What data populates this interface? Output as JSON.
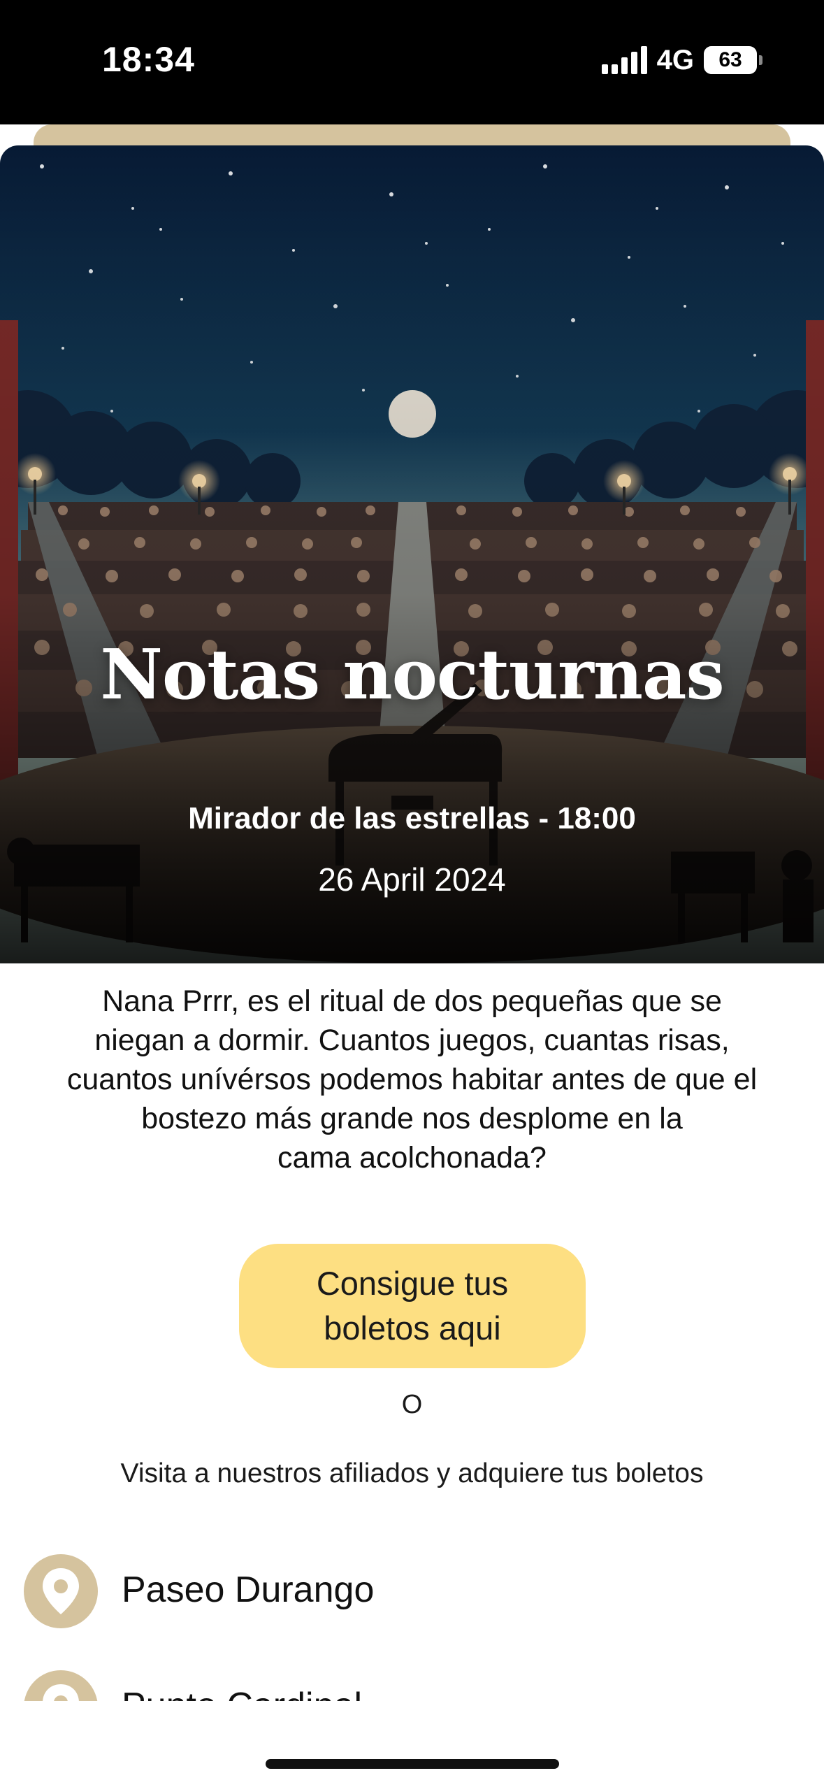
{
  "status_bar": {
    "time": "18:34",
    "network": "4G",
    "battery": "63",
    "signal_icon": "cellular-signal-icon",
    "battery_icon": "battery-icon"
  },
  "event": {
    "title": "Notas nocturnas",
    "venue_time": "Mirador de las estrellas - 18:00",
    "date": "26 April 2024",
    "description": "Nana Prrr, es el ritual  de dos pequeñas que se\nniegan a dormir. Cuantos juegos, cuantas risas,\ncuantos unívérsos podemos habitar antes de que el\nbostezo más grande nos desplome en la\ncama acolchonada?"
  },
  "cta": {
    "ticket_button": "Consigue tus\nboletos aqui",
    "or_text": "O",
    "affiliates_prompt": "Visita a nuestros afiliados y adquiere tus boletos"
  },
  "affiliates": [
    {
      "name": "Paseo Durango",
      "icon": "location-pin-icon"
    },
    {
      "name": "Punto Cardinal",
      "icon": "location-pin-icon"
    }
  ],
  "colors": {
    "accent_gold": "#d5c39e",
    "button_yellow": "#fddf82",
    "sky_top": "#071a34",
    "sky_bottom": "#5d8a92"
  }
}
